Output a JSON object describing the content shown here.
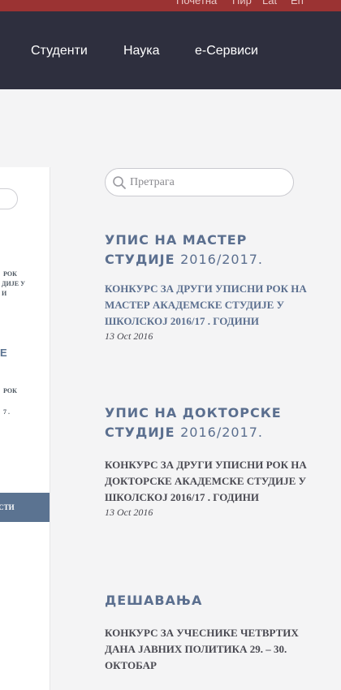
{
  "topbar": {
    "links": [
      "Почетна",
      "Пир",
      "Lat",
      "En"
    ]
  },
  "nav": {
    "items": [
      "Студенти",
      "Наука",
      "е-Сервиси"
    ]
  },
  "search": {
    "placeholder": "Претрага"
  },
  "sidebar_partial": {
    "lines_a": [
      "РОК",
      "ДИЈЕ У",
      "И"
    ],
    "emphasis_a": "Е",
    "lines_b": [
      "РОК",
      "7 ."
    ],
    "news_button": "ОВОСТИ"
  },
  "sections": [
    {
      "heading": "УПИС НА МАСТЕР СТУДИЈЕ",
      "year": "2016/2017.",
      "post_title": "КОНКУРС ЗА ДРУГИ УПИСНИ РОК НА МАСТЕР АКАДЕМСКЕ СТУДИЈЕ У ШКОЛСКОЈ 2016/17 . ГОДИНИ",
      "post_date": "13 Oct 2016"
    },
    {
      "heading": "УПИС НА ДОКТОРСКЕ СТУДИЈЕ",
      "year": "2016/2017.",
      "post_title": "КОНКУРС ЗА ДРУГИ УПИСНИ РОК НА ДОКТОРСКЕ АКАДЕМСКЕ СТУДИЈЕ У ШКОЛСКОЈ 2016/17 . ГОДИНИ",
      "post_date": "13 Oct 2016"
    },
    {
      "heading": "ДЕШАВАЊА",
      "post_title": "КОНКУРС ЗА УЧЕСНИКЕ ЧЕТВРТИХ ДАНА ЈАВНИХ ПОЛИТИКА 29. – 30. ОКТОБАР"
    }
  ]
}
